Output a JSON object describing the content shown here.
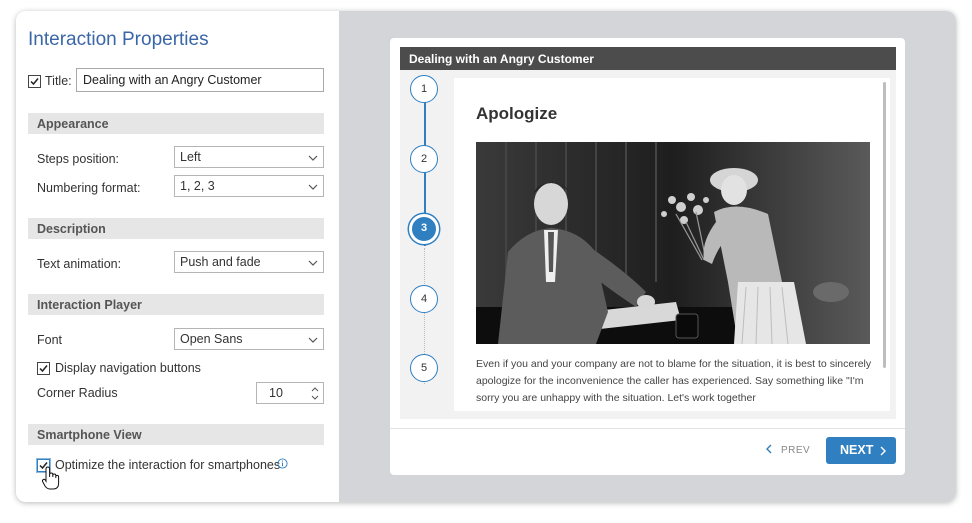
{
  "panel": {
    "title": "Interaction Properties",
    "title_field": {
      "checked": true,
      "label": "Title:",
      "value": "Dealing with an Angry Customer"
    },
    "appearance": {
      "header": "Appearance",
      "steps_position_label": "Steps position:",
      "steps_position_value": "Left",
      "numbering_format_label": "Numbering format:",
      "numbering_format_value": "1, 2, 3"
    },
    "description": {
      "header": "Description",
      "text_animation_label": "Text animation:",
      "text_animation_value": "Push and fade"
    },
    "player": {
      "header": "Interaction Player",
      "font_label": "Font",
      "font_value": "Open Sans",
      "display_nav_label": "Display navigation buttons",
      "display_nav_checked": true,
      "corner_radius_label": "Corner Radius",
      "corner_radius_value": "10"
    },
    "smartphone": {
      "header": "Smartphone View",
      "optimize_label": "Optimize the interaction for smartphones",
      "optimize_checked": true
    }
  },
  "preview": {
    "header_title": "Dealing with an Angry Customer",
    "steps": [
      "1",
      "2",
      "3",
      "4",
      "5"
    ],
    "active_step": 3,
    "content_title": "Apologize",
    "content_text": "Even if you and your company are not to blame for the situation, it is best to sincerely apologize for the inconvenience the caller has experienced. Say something like \"I'm sorry you are unhappy with the situation. Let's work together",
    "prev_label": "PREV",
    "next_label": "NEXT"
  },
  "colors": {
    "accent": "#2f7fc1",
    "title_blue": "#3a66a7",
    "preview_bg": "#d3d5d8",
    "player_header": "#4c4c4c"
  }
}
